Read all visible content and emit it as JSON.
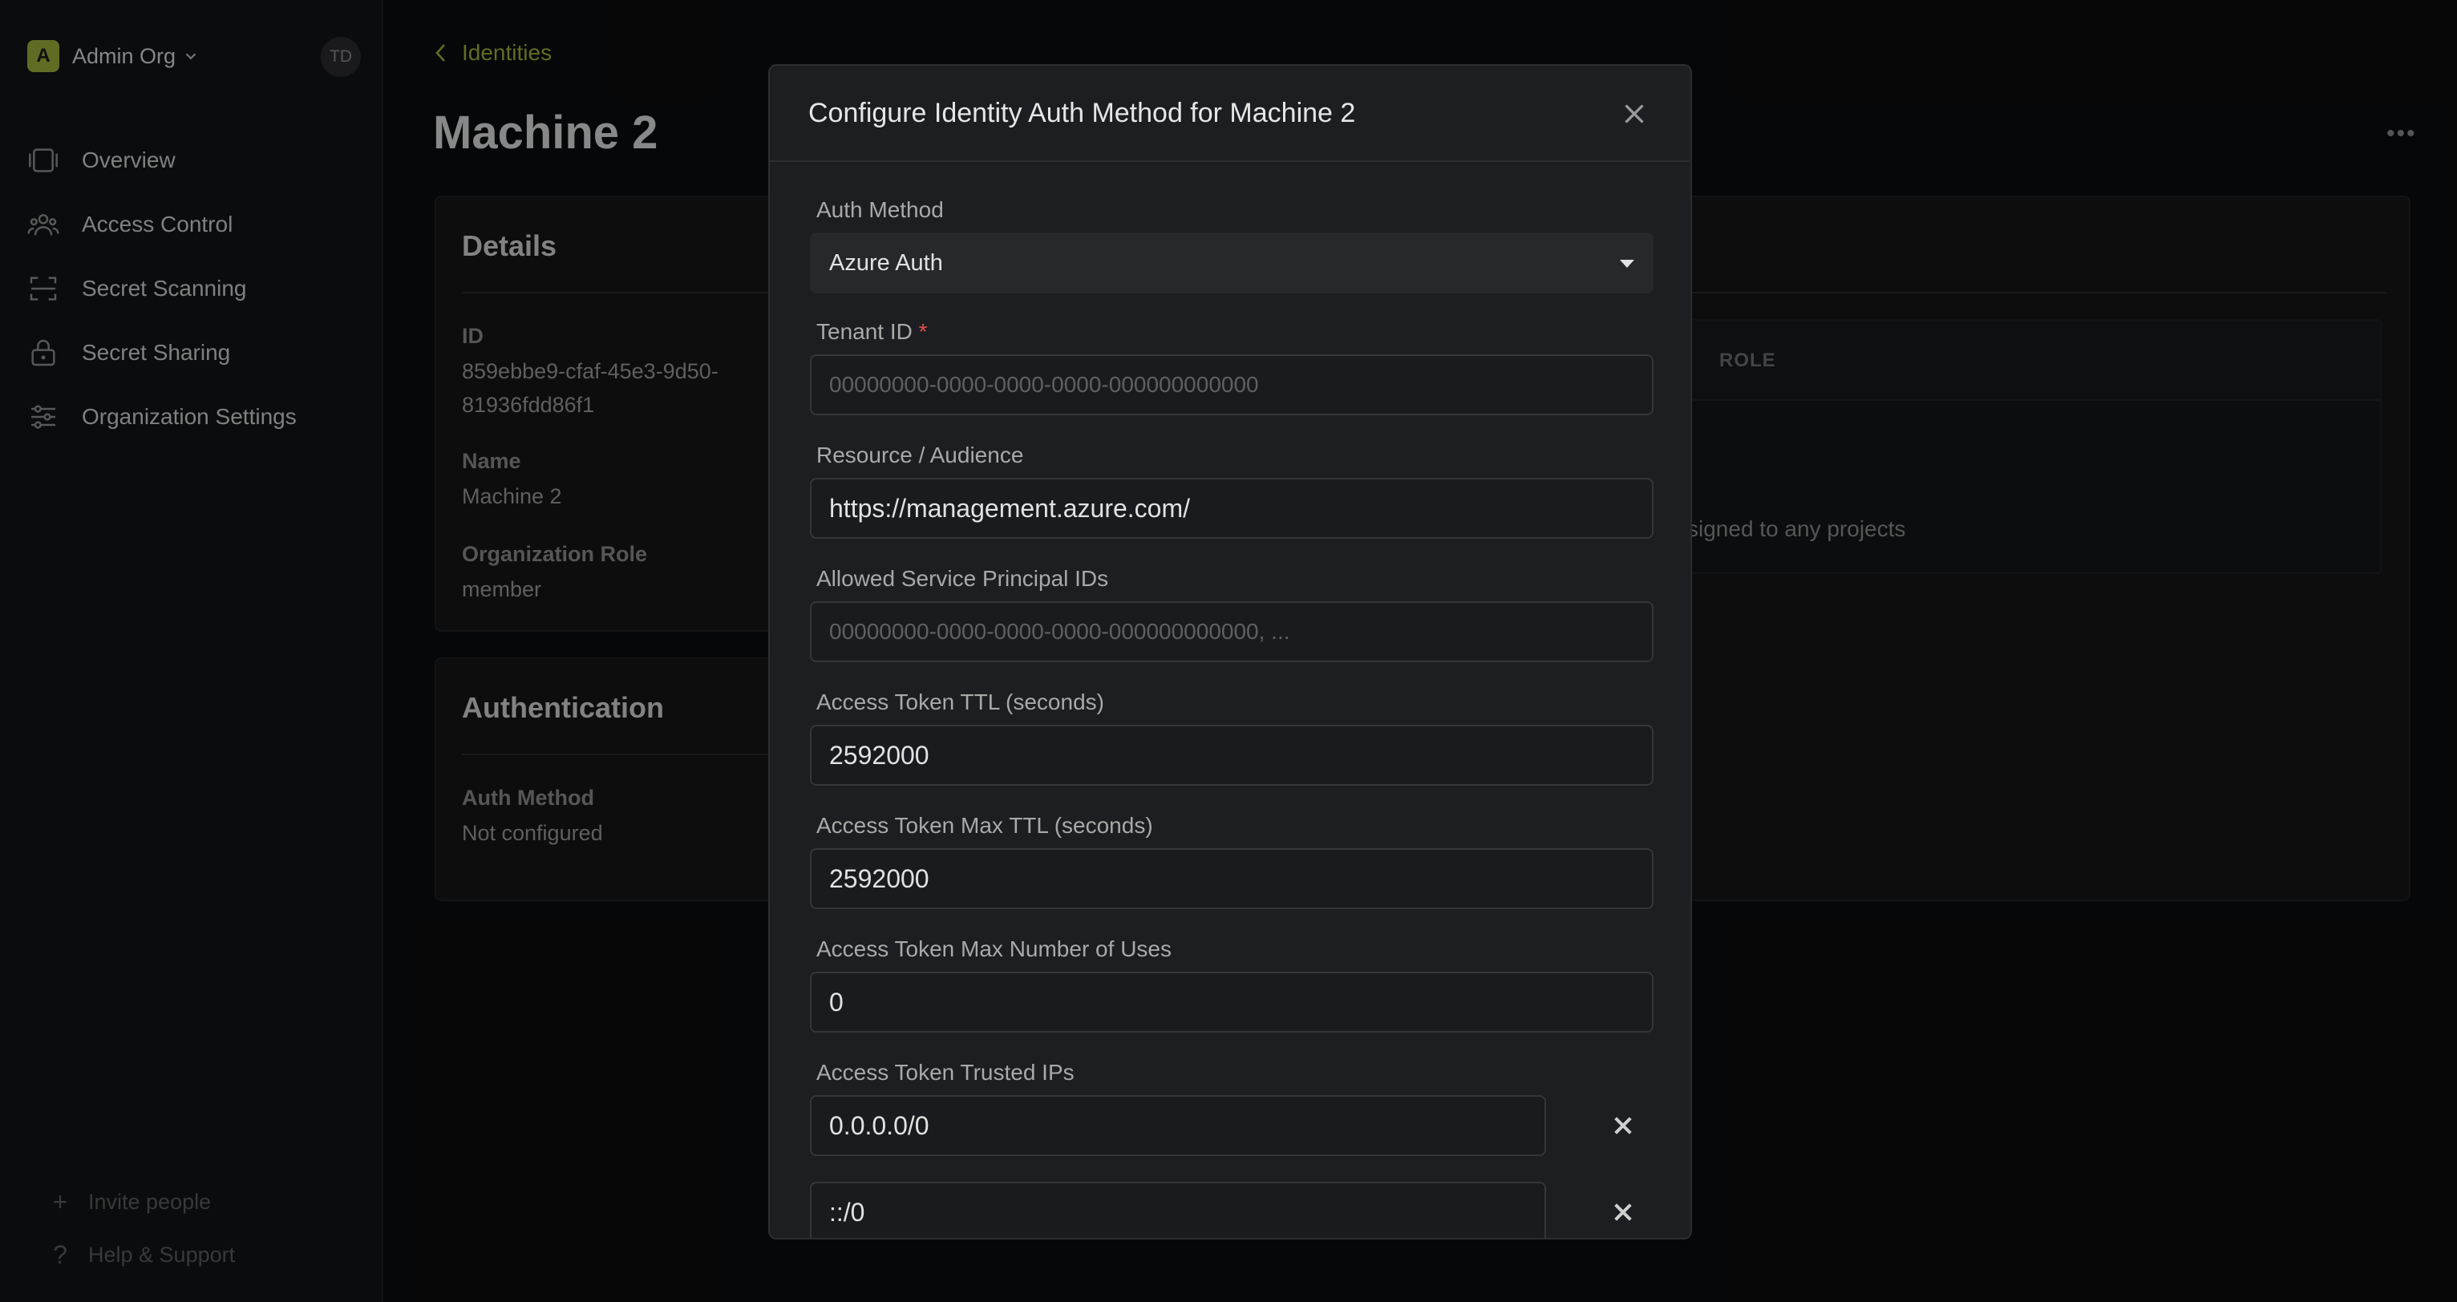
{
  "sidebar": {
    "org_initial": "A",
    "org_name": "Admin Org",
    "avatar": "TD",
    "items": [
      {
        "label": "Overview",
        "icon": "overview-icon"
      },
      {
        "label": "Access Control",
        "icon": "users-icon"
      },
      {
        "label": "Secret Scanning",
        "icon": "scan-icon"
      },
      {
        "label": "Secret Sharing",
        "icon": "lock-icon"
      },
      {
        "label": "Organization Settings",
        "icon": "sliders-icon"
      }
    ],
    "bottom": [
      {
        "label": "Invite people",
        "icon": "plus-icon"
      },
      {
        "label": "Help & Support",
        "icon": "question-icon"
      }
    ]
  },
  "breadcrumb": "Identities",
  "page_title": "Machine 2",
  "details": {
    "title": "Details",
    "id_label": "ID",
    "id_line1": "859ebbe9-cfaf-45e3-9d50-",
    "id_line2": "81936fdd86f1",
    "name_label": "Name",
    "name_value": "Machine 2",
    "role_label": "Organization Role",
    "role_value": "member"
  },
  "authentication": {
    "title": "Authentication",
    "method_label": "Auth Method",
    "method_value": "Not configured"
  },
  "projects": {
    "role_header": "ROLE",
    "empty_text": "ssigned to any projects"
  },
  "modal": {
    "title": "Configure Identity Auth Method for Machine 2",
    "auth_method_label": "Auth Method",
    "auth_method_value": "Azure Auth",
    "tenant_label": "Tenant ID",
    "tenant_required": "*",
    "tenant_placeholder": "00000000-0000-0000-0000-000000000000",
    "resource_label": "Resource / Audience",
    "resource_value": "https://management.azure.com/",
    "principal_label": "Allowed Service Principal IDs",
    "principal_placeholder": "00000000-0000-0000-0000-000000000000, ...",
    "ttl_label": "Access Token TTL (seconds)",
    "ttl_value": "2592000",
    "max_ttl_label": "Access Token Max TTL (seconds)",
    "max_ttl_value": "2592000",
    "max_uses_label": "Access Token Max Number of Uses",
    "max_uses_value": "0",
    "trusted_ips_label": "Access Token Trusted IPs",
    "trusted_ips": [
      "0.0.0.0/0",
      "::/0"
    ]
  },
  "colors": {
    "accent": "#9bae3a",
    "required": "#e0524e"
  }
}
